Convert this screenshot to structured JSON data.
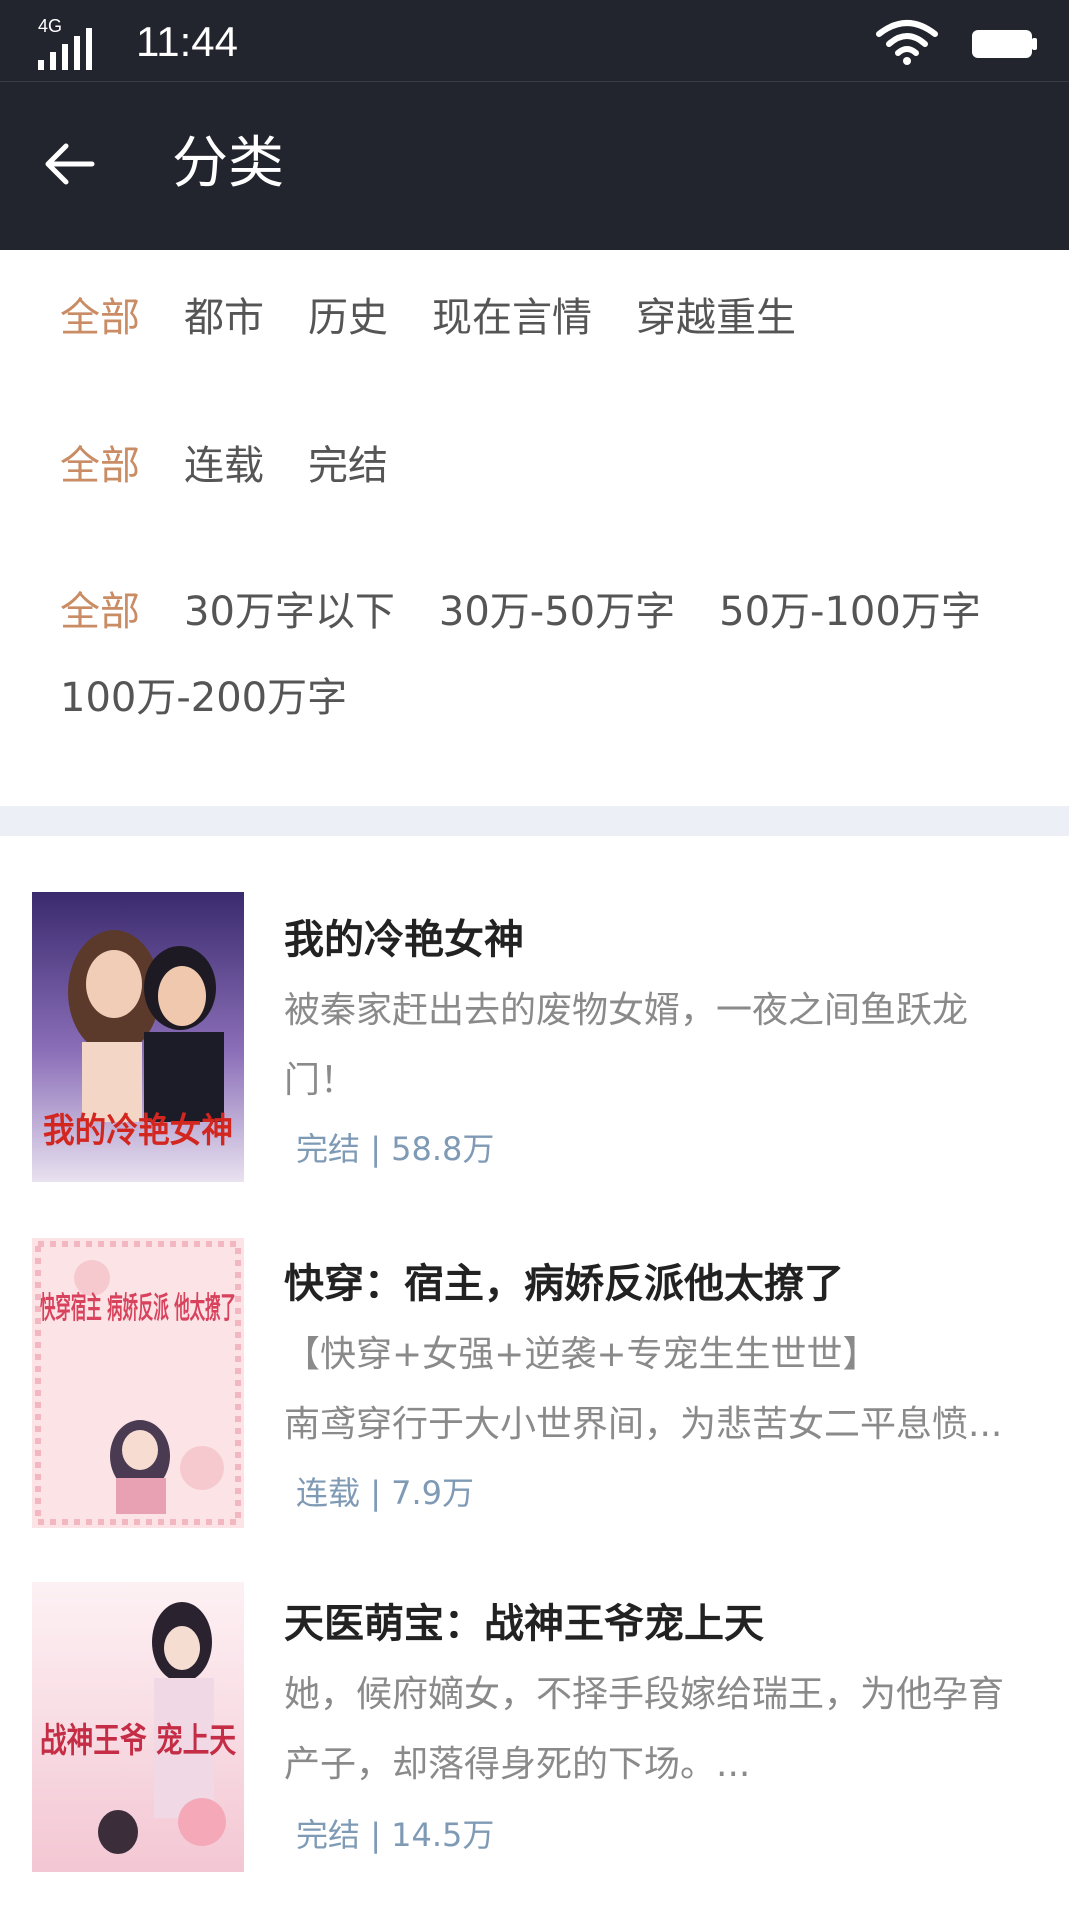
{
  "status_bar": {
    "network": "4G",
    "time": "11:44"
  },
  "nav": {
    "title": "分类"
  },
  "filters": {
    "category": [
      "全部",
      "都市",
      "历史",
      "现在言情",
      "穿越重生"
    ],
    "status": [
      "全部",
      "连载",
      "完结"
    ],
    "word_count": [
      "全部",
      "30万字以下",
      "30万-50万字",
      "50万-100万字",
      "100万-200万字"
    ],
    "active_index": 0
  },
  "books": [
    {
      "title": "我的冷艳女神",
      "desc": "被秦家赶出去的废物女婿，一夜之间鱼跃龙门！",
      "status": "完结",
      "words": "58.8万",
      "cover_text": "我的冷艳女神",
      "cover_colors": [
        "#3a2a6e",
        "#c8b6e0"
      ]
    },
    {
      "title": "快穿：宿主，病娇反派他太撩了",
      "desc_line1": "【快穿+女强+逆袭+专宠生生世世】",
      "desc": "南鸢穿行于大小世界间，为悲苦女二平息愤...",
      "status": "连载",
      "words": "7.9万",
      "cover_text": "快穿宿主 病娇反派 他太撩了",
      "cover_colors": [
        "#fbe3e6",
        "#f6c9cf"
      ]
    },
    {
      "title": "天医萌宝：战神王爷宠上天",
      "desc": "她，候府嫡女，不择手段嫁给瑞王，为他孕育产子，却落得身死的下场。...",
      "status": "完结",
      "words": "14.5万",
      "cover_text": "战神王爷 宠上天",
      "cover_colors": [
        "#fde9ee",
        "#f3c7d3"
      ]
    }
  ],
  "meta_separator": "|",
  "colors": {
    "header": "#23252e",
    "active": "#c98c64",
    "meta": "#7f9ab5",
    "divider": "#eceff5"
  }
}
